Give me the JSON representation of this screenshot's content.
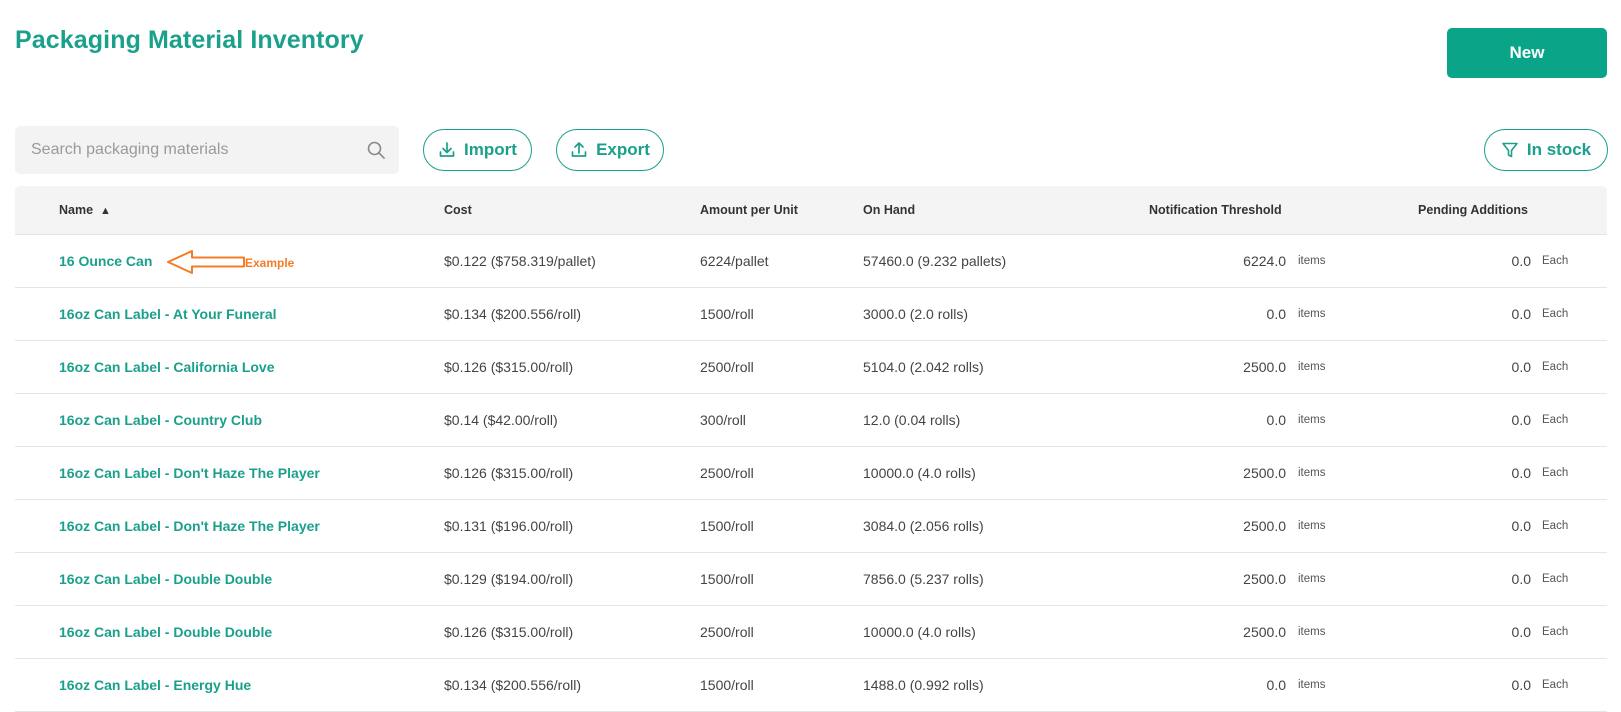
{
  "header": {
    "title": "Packaging Material Inventory",
    "new_label": "New"
  },
  "toolbar": {
    "search_placeholder": "Search packaging materials",
    "search_value": "",
    "import_label": "Import",
    "export_label": "Export",
    "filter_label": "In stock"
  },
  "table": {
    "columns": {
      "name": "Name",
      "sort_indicator": "▲",
      "cost": "Cost",
      "amount": "Amount per Unit",
      "on_hand": "On Hand",
      "threshold": "Notification Threshold",
      "pending": "Pending Additions"
    },
    "rows": [
      {
        "name": "16 Ounce Can",
        "cost": "$0.122 ($758.319/pallet)",
        "amount": "6224/pallet",
        "on_hand": "57460.0 (9.232 pallets)",
        "threshold": "6224.0",
        "threshold_unit": "items",
        "pending": "0.0",
        "pending_unit": "Each"
      },
      {
        "name": "16oz Can Label - At Your Funeral",
        "cost": "$0.134 ($200.556/roll)",
        "amount": "1500/roll",
        "on_hand": "3000.0 (2.0 rolls)",
        "threshold": "0.0",
        "threshold_unit": "items",
        "pending": "0.0",
        "pending_unit": "Each"
      },
      {
        "name": "16oz Can Label - California Love",
        "cost": "$0.126 ($315.00/roll)",
        "amount": "2500/roll",
        "on_hand": "5104.0 (2.042 rolls)",
        "threshold": "2500.0",
        "threshold_unit": "items",
        "pending": "0.0",
        "pending_unit": "Each"
      },
      {
        "name": "16oz Can Label - Country Club",
        "cost": "$0.14 ($42.00/roll)",
        "amount": "300/roll",
        "on_hand": "12.0 (0.04 rolls)",
        "threshold": "0.0",
        "threshold_unit": "items",
        "pending": "0.0",
        "pending_unit": "Each"
      },
      {
        "name": "16oz Can Label - Don't Haze The Player",
        "cost": "$0.126 ($315.00/roll)",
        "amount": "2500/roll",
        "on_hand": "10000.0 (4.0 rolls)",
        "threshold": "2500.0",
        "threshold_unit": "items",
        "pending": "0.0",
        "pending_unit": "Each"
      },
      {
        "name": "16oz Can Label - Don't Haze The Player",
        "cost": "$0.131 ($196.00/roll)",
        "amount": "1500/roll",
        "on_hand": "3084.0 (2.056 rolls)",
        "threshold": "2500.0",
        "threshold_unit": "items",
        "pending": "0.0",
        "pending_unit": "Each"
      },
      {
        "name": "16oz Can Label - Double Double",
        "cost": "$0.129 ($194.00/roll)",
        "amount": "1500/roll",
        "on_hand": "7856.0 (5.237 rolls)",
        "threshold": "2500.0",
        "threshold_unit": "items",
        "pending": "0.0",
        "pending_unit": "Each"
      },
      {
        "name": "16oz Can Label - Double Double",
        "cost": "$0.126 ($315.00/roll)",
        "amount": "2500/roll",
        "on_hand": "10000.0 (4.0 rolls)",
        "threshold": "2500.0",
        "threshold_unit": "items",
        "pending": "0.0",
        "pending_unit": "Each"
      },
      {
        "name": "16oz Can Label - Energy Hue",
        "cost": "$0.134 ($200.556/roll)",
        "amount": "1500/roll",
        "on_hand": "1488.0 (0.992 rolls)",
        "threshold": "0.0",
        "threshold_unit": "items",
        "pending": "0.0",
        "pending_unit": "Each"
      }
    ]
  },
  "annotation": {
    "label": "Example",
    "icon": "arrow-left-icon",
    "color": "#f47c27"
  },
  "colors": {
    "accent": "#1aa08b",
    "button_fill": "#0aa589"
  }
}
